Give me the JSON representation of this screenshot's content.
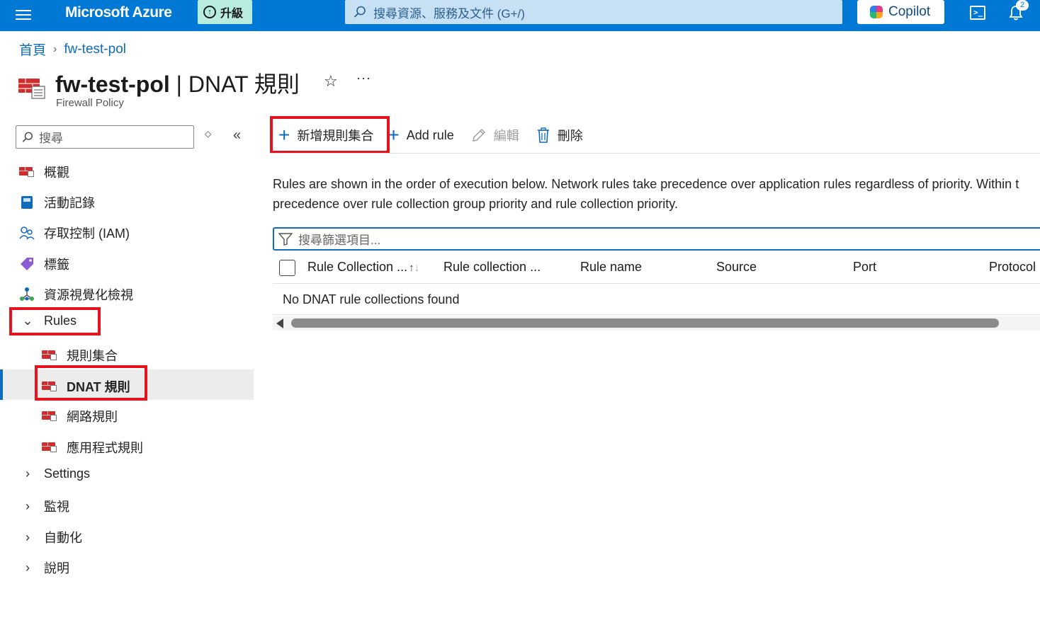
{
  "topbar": {
    "brand": "Microsoft Azure",
    "upgrade_label": "升級",
    "search_placeholder": "搜尋資源、服務及文件 (G+/)",
    "copilot_label": "Copilot",
    "notification_count": "2"
  },
  "breadcrumb": {
    "home": "首頁",
    "current": "fw-test-pol"
  },
  "header": {
    "resource_name": "fw-test-pol",
    "separator": " | ",
    "blade_name": "DNAT 規則",
    "resource_type": "Firewall Policy",
    "favorite_glyph": "☆",
    "more_glyph": "···"
  },
  "sidebar": {
    "search_placeholder": "搜尋",
    "items": [
      {
        "label": "概觀",
        "icon": "firewall-icon"
      },
      {
        "label": "活動記錄",
        "icon": "activity-log-icon"
      },
      {
        "label": "存取控制 (IAM)",
        "icon": "people-icon"
      },
      {
        "label": "標籤",
        "icon": "tag-icon"
      },
      {
        "label": "資源視覺化檢視",
        "icon": "resource-visualizer-icon"
      }
    ],
    "rules_group": {
      "label": "Rules",
      "children": [
        {
          "label": "規則集合"
        },
        {
          "label": "DNAT 規則",
          "selected": true
        },
        {
          "label": "網路規則"
        },
        {
          "label": "應用程式規則"
        }
      ]
    },
    "collapsed_groups": [
      "Settings",
      "監視",
      "自動化",
      "說明"
    ]
  },
  "toolbar": {
    "add_collection": "新增規則集合",
    "add_rule": "Add rule",
    "edit": "編輯",
    "delete": "刪除"
  },
  "main": {
    "info_line1": "Rules are shown in the order of execution below. Network rules take precedence over application rules regardless of priority. Within t",
    "info_line2": "precedence over rule collection group priority and rule collection priority.",
    "filter_placeholder": "搜尋篩選項目...",
    "columns": [
      "Rule Collection ...",
      "Rule collection ...",
      "Rule name",
      "Source",
      "Port",
      "Protocol"
    ],
    "empty_message": "No DNAT rule collections found"
  },
  "colors": {
    "topbar": "#0078d4",
    "accent": "#0f6cbd",
    "highlight_box": "#e3141e",
    "selected_row": "#ececec"
  }
}
